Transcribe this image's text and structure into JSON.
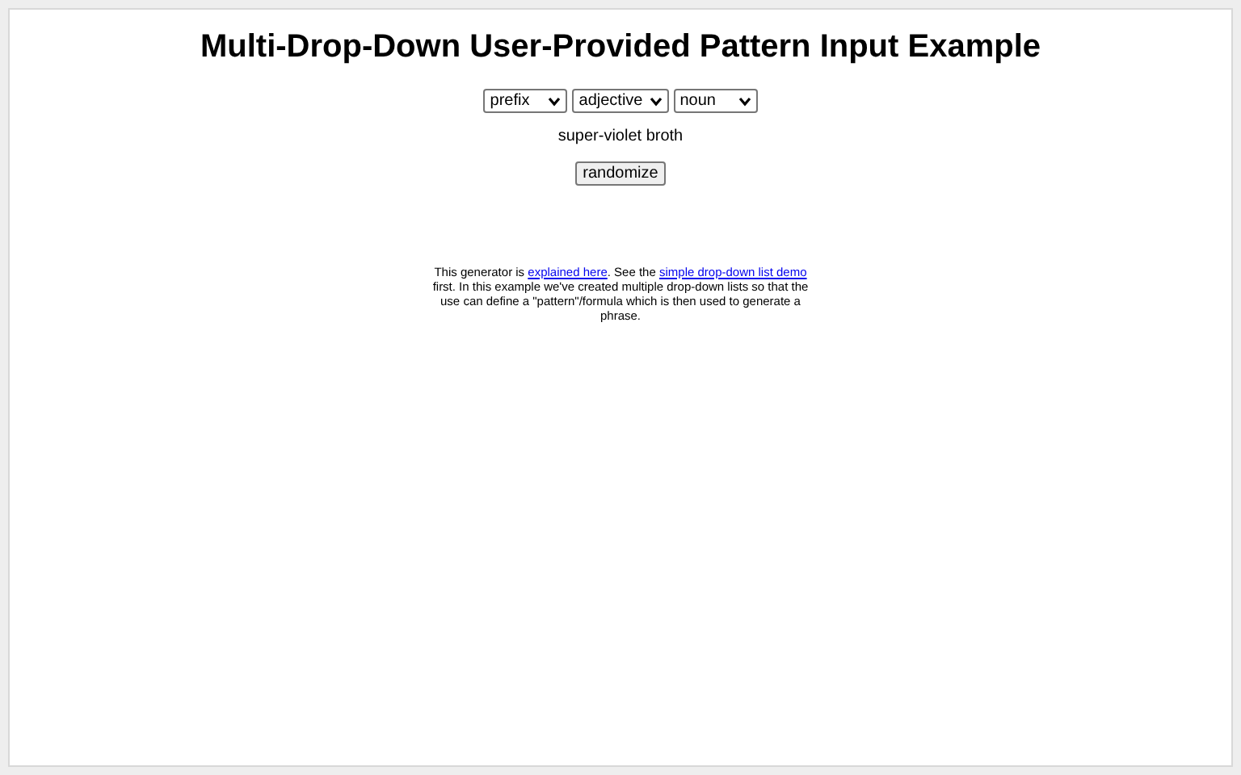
{
  "title": "Multi-Drop-Down User-Provided Pattern Input Example",
  "dropdowns": [
    {
      "value": "prefix"
    },
    {
      "value": "adjective"
    },
    {
      "value": "noun"
    }
  ],
  "result": "super-violet broth",
  "button": "randomize",
  "description": [
    {
      "kind": "text",
      "text": "This generator is "
    },
    {
      "kind": "link",
      "text": "explained here"
    },
    {
      "kind": "text",
      "text": ". See the "
    },
    {
      "kind": "link",
      "text": "simple drop-down list demo"
    },
    {
      "kind": "text",
      "text": " first. In this example we've created multiple drop-down lists so that the use can define a \"pattern\"/formula which is then used to generate a phrase."
    }
  ]
}
